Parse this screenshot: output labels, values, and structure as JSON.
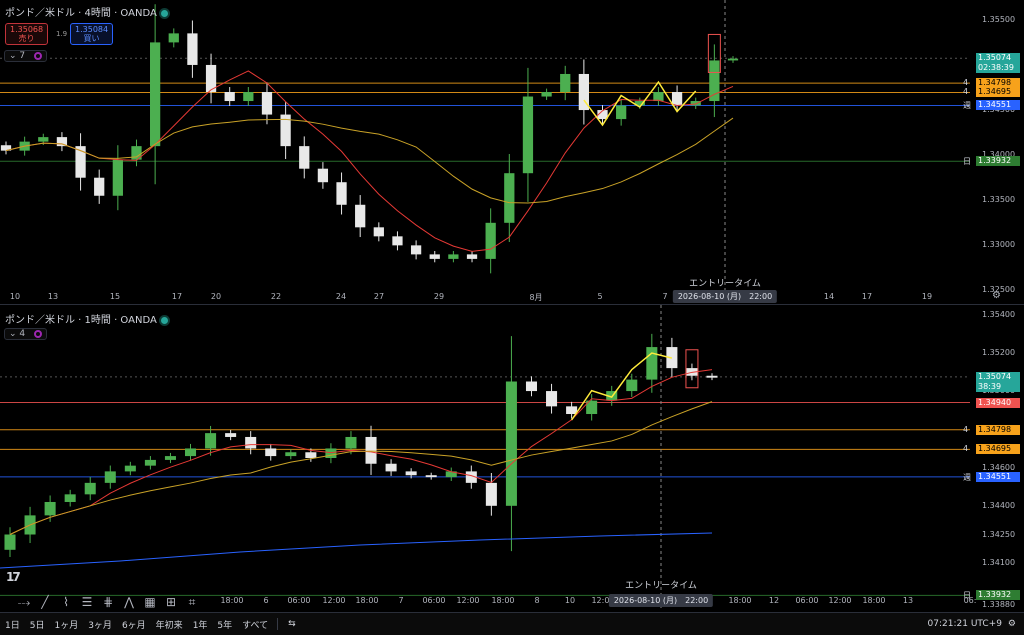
{
  "top_chart": {
    "title": "ポンド／米ドル · 4時間 · OANDA",
    "sell_price": "1.35068",
    "sell_label": "売り",
    "spread": "1.9",
    "buy_price": "1.35084",
    "buy_label": "買い",
    "indicator_count": "7",
    "price_axis": [
      "1.35500",
      "1.35000",
      "1.34500",
      "1.34000",
      "1.33500",
      "1.33000",
      "1.32500"
    ],
    "price_axis_values": [
      1.355,
      1.35,
      1.345,
      1.34,
      1.335,
      1.33,
      1.325
    ],
    "time_axis": [
      "10",
      "13",
      "15",
      "17",
      "20",
      "22",
      "24",
      "27",
      "29",
      "8月",
      "5",
      "7",
      "14",
      "17",
      "19"
    ],
    "cursor_date": "2026-08-10 (月)　22:00",
    "entry_label": "エントリータイム",
    "levels": [
      {
        "mark": "",
        "price": "1.35074",
        "sub": "02:38:39",
        "value": 1.35074,
        "color": "#26a69a"
      },
      {
        "mark": "4",
        "price": "1.34798",
        "value": 1.34798,
        "color": "#f7a21b"
      },
      {
        "mark": "4",
        "price": "1.34695",
        "value": 1.34695,
        "color": "#f7a21b"
      },
      {
        "mark": "週",
        "price": "1.34551",
        "value": 1.34551,
        "color": "#2962ff"
      },
      {
        "mark": "日",
        "price": "1.33932",
        "value": 1.33932,
        "color": "#2e7d32"
      }
    ]
  },
  "bottom_chart": {
    "title": "ポンド／米ドル · 1時間 · OANDA",
    "indicator_count": "4",
    "price_axis": [
      "1.35400",
      "1.35200",
      "1.35000",
      "1.34800",
      "1.34600",
      "1.34400",
      "1.34250",
      "1.34100",
      "1.33880"
    ],
    "price_axis_values": [
      1.354,
      1.352,
      1.35,
      1.348,
      1.346,
      1.344,
      1.3425,
      1.341,
      1.3388
    ],
    "time_axis": [
      "18:00",
      "6",
      "06:00",
      "12:00",
      "18:00",
      "7",
      "06:00",
      "12:00",
      "18:00",
      "8",
      "10",
      "12:00",
      "18:00",
      "12",
      "06:00",
      "12:00",
      "18:00",
      "13",
      "06:"
    ],
    "cursor_date": "2026-08-10 (月)　22:00",
    "entry_label": "エントリータイム",
    "levels": [
      {
        "mark": "",
        "price": "1.35074",
        "sub": "38:39",
        "value": 1.35074,
        "color": "#26a69a"
      },
      {
        "mark": "",
        "price": "1.34940",
        "value": 1.3494,
        "color": "#ef5350"
      },
      {
        "mark": "4",
        "price": "1.34798",
        "value": 1.34798,
        "color": "#f7a21b"
      },
      {
        "mark": "4",
        "price": "1.34695",
        "value": 1.34695,
        "color": "#f7a21b"
      },
      {
        "mark": "週",
        "price": "1.34551",
        "value": 1.34551,
        "color": "#2962ff"
      },
      {
        "mark": "日",
        "price": "1.33932",
        "value": 1.33932,
        "color": "#2e7d32"
      }
    ]
  },
  "bottom_bar": {
    "ranges": [
      "1日",
      "5日",
      "1ヶ月",
      "3ヶ月",
      "6ヶ月",
      "年初来",
      "1年",
      "5年",
      "すべて"
    ],
    "clock": "07:21:21 UTC+9"
  },
  "toolbar": {
    "tools": [
      "cursor-icon",
      "line-icon",
      "ray-icon",
      "fib-icon",
      "channel-icon",
      "pattern-icon",
      "text-icon",
      "measure-icon",
      "zoom-icon"
    ]
  },
  "chart_data": [
    {
      "type": "candlestick",
      "title": "ポンド／米ドル · 4時間 · OANDA",
      "ylim": [
        1.3235,
        1.3572
      ],
      "last_price": 1.35074,
      "approx_closes": [
        1.3405,
        1.3415,
        1.342,
        1.341,
        1.3375,
        1.3355,
        1.3395,
        1.341,
        1.3525,
        1.3535,
        1.35,
        1.347,
        1.346,
        1.347,
        1.3445,
        1.341,
        1.3385,
        1.337,
        1.3345,
        1.332,
        1.331,
        1.33,
        1.329,
        1.3285,
        1.329,
        1.3285,
        1.3325,
        1.338,
        1.3465,
        1.347,
        1.349,
        1.345,
        1.344,
        1.3455,
        1.346,
        1.347,
        1.3455,
        1.346,
        1.3505,
        1.3507
      ],
      "horizontal_levels": [
        1.34798,
        1.34695,
        1.34551,
        1.33932
      ]
    },
    {
      "type": "candlestick",
      "title": "ポンド／米ドル · 1時間 · OANDA",
      "ylim": [
        1.3385,
        1.3545
      ],
      "last_price": 1.35074,
      "approx_closes": [
        1.3425,
        1.3435,
        1.3442,
        1.3446,
        1.3452,
        1.3458,
        1.3461,
        1.3464,
        1.3466,
        1.347,
        1.3478,
        1.3476,
        1.347,
        1.3466,
        1.3468,
        1.3465,
        1.347,
        1.3476,
        1.3462,
        1.3458,
        1.3456,
        1.3455,
        1.3458,
        1.3452,
        1.344,
        1.3505,
        1.35,
        1.3492,
        1.3488,
        1.3495,
        1.35,
        1.3506,
        1.3523,
        1.3512,
        1.3508,
        1.3507
      ],
      "horizontal_levels": [
        1.3494,
        1.34798,
        1.34695,
        1.34551,
        1.33932
      ]
    }
  ]
}
